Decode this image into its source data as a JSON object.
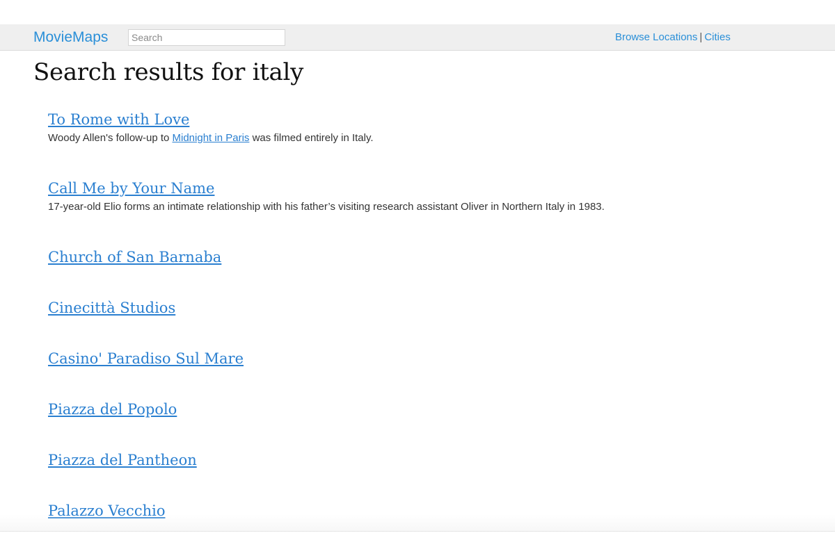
{
  "header": {
    "brand": "MovieMaps",
    "search_placeholder": "Search",
    "nav_links": [
      "Browse Locations",
      "Cities"
    ],
    "nav_separator": "|"
  },
  "page_title": "Search results for italy",
  "results": [
    {
      "title": "To Rome with Love",
      "desc_before": "Woody Allen's follow-up to ",
      "desc_link": "Midnight in Paris",
      "desc_after": " was filmed entirely in Italy."
    },
    {
      "title": "Call Me by Your Name",
      "desc": "17-year-old Elio forms an intimate relationship with his father’s visiting research assistant Oliver in Northern Italy in 1983."
    },
    {
      "title": "Church of San Barnaba"
    },
    {
      "title": "Cinecittà Studios"
    },
    {
      "title": "Casino' Paradiso Sul Mare"
    },
    {
      "title": "Piazza del Popolo"
    },
    {
      "title": "Piazza del Pantheon"
    },
    {
      "title": "Palazzo Vecchio"
    }
  ],
  "colors": {
    "link": "#2a7fd0",
    "brand": "#2a8fd8",
    "navbar_bg": "#efefef",
    "text": "#333333"
  }
}
